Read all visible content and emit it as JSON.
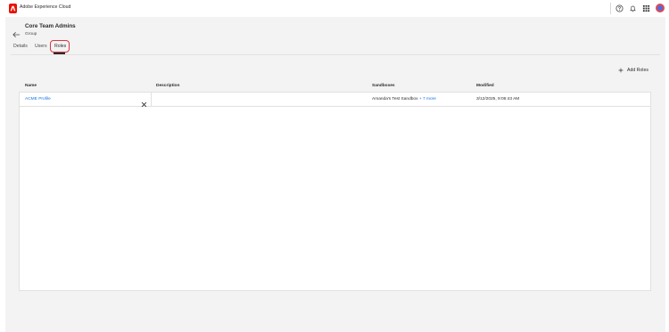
{
  "app": {
    "brand_name": "Adobe Experience Cloud",
    "logo_icon": "adobe-logo-icon",
    "brand_color": "#eb1000"
  },
  "header_icons": [
    "help-icon",
    "notifications-icon",
    "app-switcher-icon",
    "user-avatar"
  ],
  "page": {
    "title": "Core Team Admins",
    "subtitle": "Group",
    "back_icon": "back-arrow-icon"
  },
  "tabs": [
    {
      "label": "Details",
      "active": false
    },
    {
      "label": "Users",
      "active": false
    },
    {
      "label": "Roles",
      "active": true
    }
  ],
  "actions": {
    "add_roles_label": "Add Roles"
  },
  "table": {
    "columns": [
      "Name",
      "Description",
      "Sandboxes",
      "Modified"
    ],
    "rows": [
      {
        "name": "ACME Profile",
        "description": "",
        "sandboxes": "Amanda's Test Sandbox",
        "sandboxes_more": "+ 7 more",
        "modified": "3/12/2025, 9:06:43 AM"
      }
    ]
  },
  "colors": {
    "link": "#1473e6",
    "highlight": "#d7373f",
    "background": "#f3f3f3"
  }
}
